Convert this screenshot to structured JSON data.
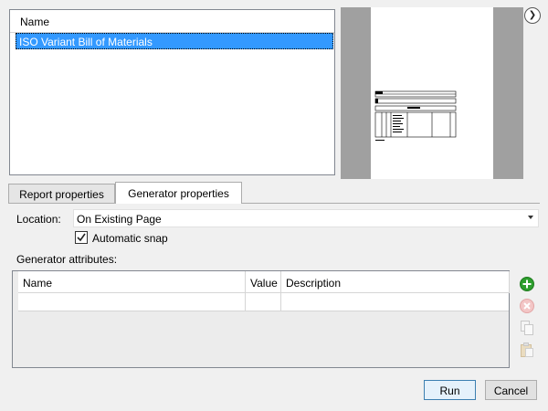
{
  "report_list": {
    "column_header": "Name",
    "items": [
      {
        "label": "ISO Variant Bill of Materials",
        "selected": true
      }
    ]
  },
  "preview": {
    "expand_icon": "chevron-right-icon"
  },
  "tabs": [
    {
      "label": "Report properties",
      "active": false
    },
    {
      "label": "Generator properties",
      "active": true
    }
  ],
  "generator": {
    "location_label": "Location:",
    "location_value": "On Existing Page",
    "automatic_snap_label": "Automatic snap",
    "automatic_snap_checked": true,
    "attributes_label": "Generator attributes:",
    "attributes_columns": [
      "Name",
      "Value",
      "Description"
    ],
    "attributes_rows": []
  },
  "side_actions": [
    {
      "icon": "add-icon",
      "color": "#2e9e2e",
      "enabled": true
    },
    {
      "icon": "remove-icon",
      "color": "#d9534f",
      "enabled": false
    },
    {
      "icon": "copy-icon",
      "enabled": false
    },
    {
      "icon": "paste-icon",
      "enabled": false
    }
  ],
  "buttons": {
    "run_label": "Run",
    "cancel_label": "Cancel"
  },
  "colors": {
    "selection": "#3399ff",
    "dialog_background": "#f0f0f0",
    "preview_background": "#a0a0a0"
  }
}
